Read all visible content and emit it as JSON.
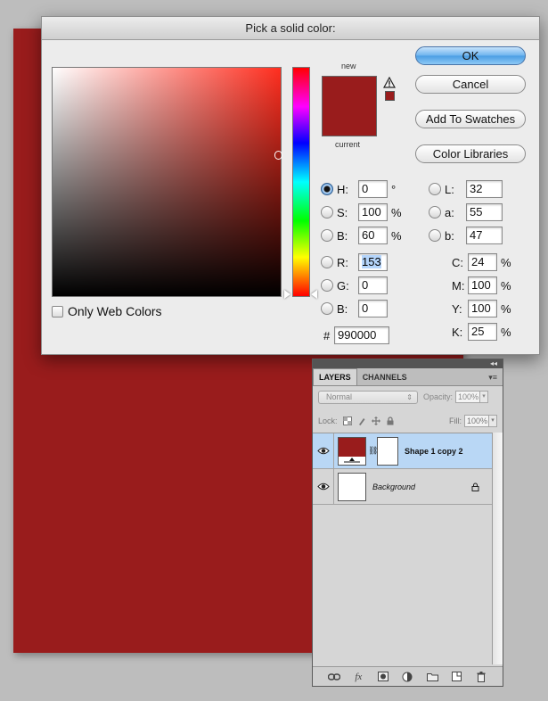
{
  "canvas": {
    "fill_color": "#991c1c"
  },
  "picker": {
    "title": "Pick a solid color:",
    "new_label": "new",
    "current_label": "current",
    "new_color": "#991c1c",
    "current_color": "#991c1c",
    "buttons": {
      "ok": "OK",
      "cancel": "Cancel",
      "add_to_swatches": "Add To Swatches",
      "color_libraries": "Color Libraries"
    },
    "only_web_colors_label": "Only Web Colors",
    "only_web_colors_checked": false,
    "hsb": [
      {
        "label": "H:",
        "value": "0",
        "unit": "°",
        "selected": true
      },
      {
        "label": "S:",
        "value": "100",
        "unit": "%",
        "selected": false
      },
      {
        "label": "B:",
        "value": "60",
        "unit": "%",
        "selected": false
      }
    ],
    "rgb": [
      {
        "label": "R:",
        "value": "153",
        "unit": "",
        "selected": false
      },
      {
        "label": "G:",
        "value": "0",
        "unit": "",
        "selected": false
      },
      {
        "label": "B:",
        "value": "0",
        "unit": "",
        "selected": false
      }
    ],
    "lab": [
      {
        "label": "L:",
        "value": "32"
      },
      {
        "label": "a:",
        "value": "55"
      },
      {
        "label": "b:",
        "value": "47"
      }
    ],
    "cmyk": [
      {
        "label": "C:",
        "value": "24",
        "unit": "%"
      },
      {
        "label": "M:",
        "value": "100",
        "unit": "%"
      },
      {
        "label": "Y:",
        "value": "100",
        "unit": "%"
      },
      {
        "label": "K:",
        "value": "25",
        "unit": "%"
      }
    ],
    "hex_label": "#",
    "hex_value": "990000"
  },
  "layers_panel": {
    "tabs": [
      "LAYERS",
      "CHANNELS"
    ],
    "active_tab": "LAYERS",
    "blend_mode": "Normal",
    "opacity_label": "Opacity:",
    "opacity_value": "100%",
    "lock_label": "Lock:",
    "fill_label": "Fill:",
    "fill_value": "100%",
    "layers": [
      {
        "name": "Shape 1 copy 2",
        "active": true,
        "thumb_color": "#991c1c"
      },
      {
        "name": "Background",
        "active": false,
        "thumb_color": "#ffffff"
      }
    ],
    "bottom_icons": [
      "link-layers-icon",
      "fx-icon",
      "add-mask-icon",
      "adjustment-layer-icon",
      "new-group-icon",
      "new-layer-icon",
      "trash-icon"
    ]
  }
}
